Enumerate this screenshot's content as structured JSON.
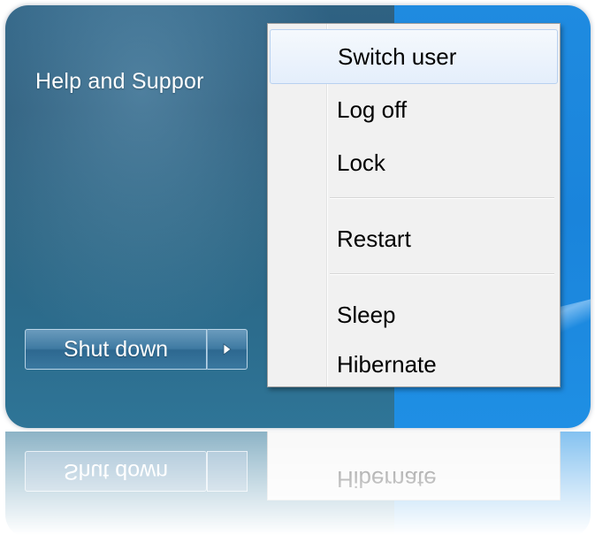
{
  "start_menu": {
    "help_item_label": "Help and Suppor",
    "shutdown_label": "Shut down",
    "arrow_icon": "triangle-right-icon"
  },
  "power_menu": {
    "items": [
      {
        "label": "Switch user",
        "highlighted": true
      },
      {
        "label": "Log off"
      },
      {
        "label": "Lock"
      },
      {
        "label": "Restart"
      },
      {
        "label": "Sleep"
      },
      {
        "label": "Hibernate"
      }
    ]
  },
  "reflection": {
    "shutdown_label": "Shut down",
    "last_item_label": "Hibernate"
  },
  "colors": {
    "start_pane": "#2d6684",
    "desktop": "#1f8be0",
    "menu_background": "#f1f1f1",
    "highlight": "#e4eefb",
    "highlight_border": "#b8d1f0"
  }
}
